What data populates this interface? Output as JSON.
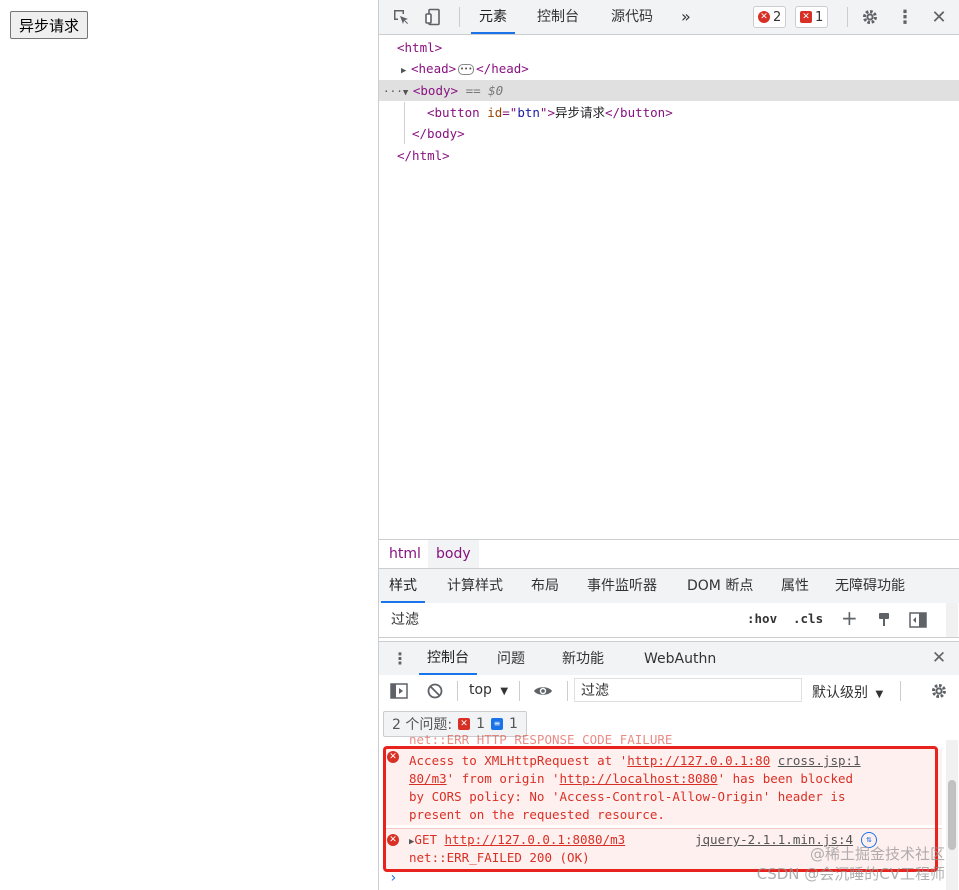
{
  "page": {
    "button_label": "异步请求"
  },
  "devtools": {
    "tabs": [
      "元素",
      "控制台",
      "源代码"
    ],
    "more_tabs_glyph": "»",
    "error_badge_count": "2",
    "issue_badge_count": "1",
    "elements": {
      "html_open": "<html>",
      "head_open": "<head>",
      "head_close": "</head>",
      "body_open": "<body>",
      "body_marker": "== $0",
      "button_open_tag": "<button",
      "button_attr_name": "id",
      "button_attr_eq": "=\"",
      "button_attr_value": "btn",
      "button_attr_close": "\">",
      "button_text": "异步请求",
      "button_close": "</button>",
      "body_close": "</body>",
      "html_close": "</html>",
      "row_dots": "···"
    },
    "breadcrumb": [
      "html",
      "body"
    ],
    "styles_tabs": [
      "样式",
      "计算样式",
      "布局",
      "事件监听器",
      "DOM 断点",
      "属性",
      "无障碍功能"
    ],
    "styles_filter_placeholder": "过滤",
    "styles_hov": ":hov",
    "styles_cls": ".cls",
    "drawer_tabs": [
      "控制台",
      "问题",
      "新功能",
      "WebAuthn"
    ],
    "console": {
      "context": "top",
      "filter_placeholder": "过滤",
      "level_select": "默认级别",
      "issues_label": "2 个问题:",
      "issues_error_count": "1",
      "issues_info_count": "1",
      "cut_line": "net::ERR_HTTP_RESPONSE_CODE_FAILURE",
      "cors_error": {
        "line1_a": "Access to XMLHttpRequest at '",
        "line1_url": "http://127.0.0.1:80",
        "line1_src": "cross.jsp:1",
        "line2_url": "80/m3",
        "line2_b": "' from origin '",
        "line2_origin": "http://localhost:8080",
        "line2_c": "' has been blocked",
        "line3": "by CORS policy: No 'Access-Control-Allow-Origin' header is",
        "line4": "present on the requested resource."
      },
      "get_error": {
        "method": "GET",
        "url": "http://127.0.0.1:8080/m3",
        "source": "jquery-2.1.1.min.js:4",
        "status": "net::ERR_FAILED 200 (OK)"
      },
      "prompt": "›"
    }
  },
  "watermark": {
    "line1": "@稀土掘金技术社区",
    "line2": "CSDN @会沉睡的CV工程师"
  },
  "colors": {
    "accent": "#1a73e8",
    "error": "#d93025",
    "highlight": "#e8221c",
    "tag": "#881280"
  }
}
